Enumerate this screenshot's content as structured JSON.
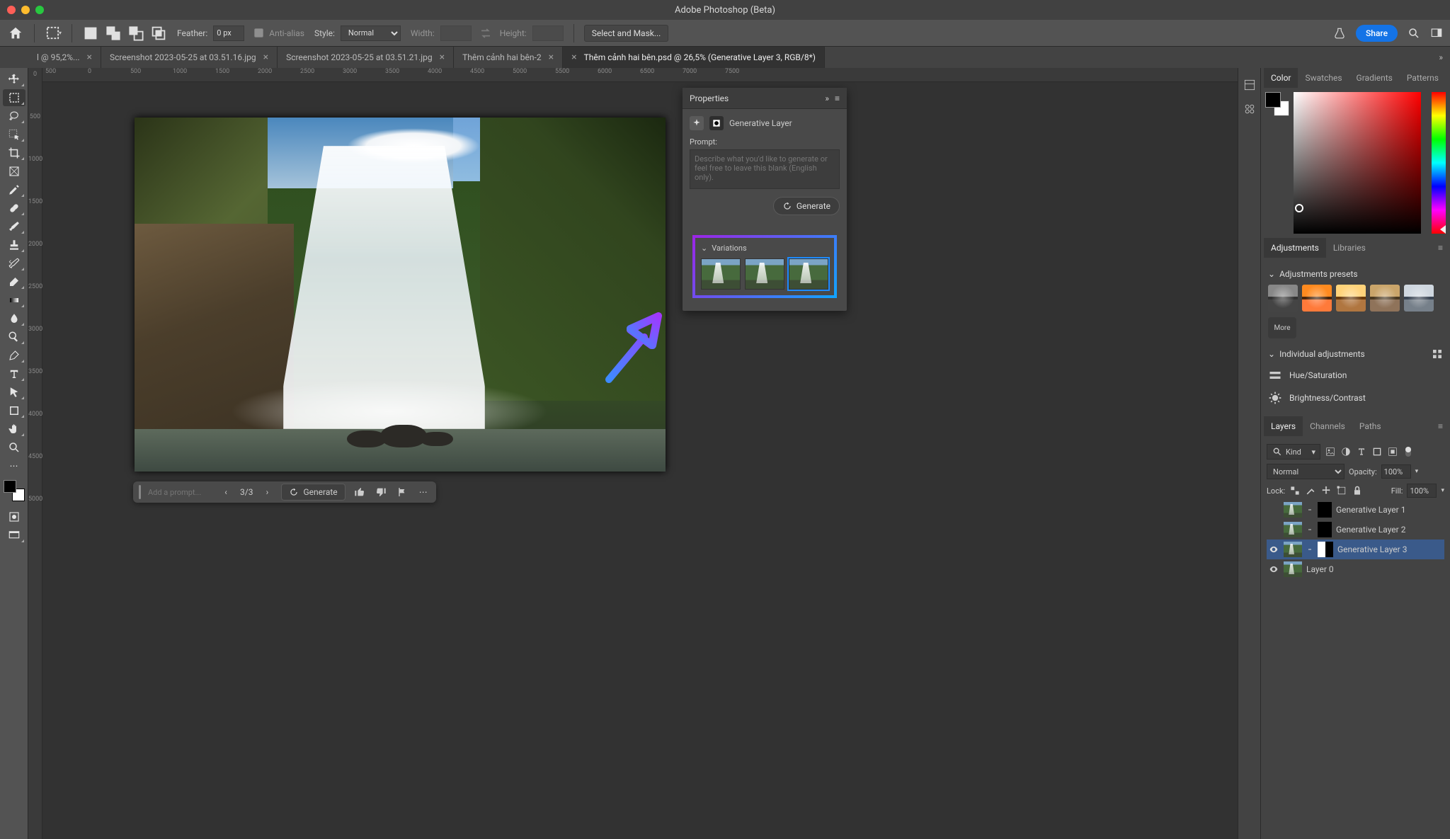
{
  "app": {
    "title": "Adobe Photoshop (Beta)"
  },
  "options": {
    "feather_label": "Feather:",
    "feather_value": "0 px",
    "antialias_label": "Anti-alias",
    "style_label": "Style:",
    "style_value": "Normal",
    "width_label": "Width:",
    "height_label": "Height:",
    "select_mask": "Select and Mask...",
    "share": "Share"
  },
  "tabs": [
    {
      "label": "l @ 95,2%...",
      "active": false
    },
    {
      "label": "Screenshot 2023-05-25 at 03.51.16.jpg",
      "active": false
    },
    {
      "label": "Screenshot 2023-05-25 at 03.51.21.jpg",
      "active": false
    },
    {
      "label": "Thêm cảnh hai bên-2",
      "active": false
    },
    {
      "label": "Thêm cảnh hai bên.psd @ 26,5% (Generative Layer 3, RGB/8*)",
      "active": true
    }
  ],
  "ruler_h": [
    "500",
    "0",
    "500",
    "1000",
    "1500",
    "2000",
    "2500",
    "3000",
    "3500",
    "4000",
    "4500",
    "5000",
    "5500",
    "6000",
    "6500",
    "7000",
    "7500"
  ],
  "ruler_v": [
    "0",
    "500",
    "1000",
    "1500",
    "2000",
    "2500",
    "3000",
    "3500",
    "4000",
    "4500",
    "5000"
  ],
  "promptbar": {
    "placeholder": "Add a prompt...",
    "counter": "3/3",
    "generate": "Generate"
  },
  "properties": {
    "title": "Properties",
    "kind": "Generative Layer",
    "prompt_label": "Prompt:",
    "prompt_placeholder": "Describe what you'd like to generate or feel free to leave this blank (English only).",
    "generate": "Generate",
    "variations_label": "Variations"
  },
  "color_tabs": [
    "Color",
    "Swatches",
    "Gradients",
    "Patterns"
  ],
  "adjustments": {
    "tabs": [
      "Adjustments",
      "Libraries"
    ],
    "presets_label": "Adjustments presets",
    "more": "More",
    "individual_label": "Individual adjustments",
    "items": [
      "Hue/Saturation",
      "Brightness/Contrast"
    ]
  },
  "layers": {
    "tabs": [
      "Layers",
      "Channels",
      "Paths"
    ],
    "filter": "Kind",
    "blend": "Normal",
    "opacity_label": "Opacity:",
    "opacity": "100%",
    "lock_label": "Lock:",
    "fill_label": "Fill:",
    "fill": "100%",
    "items": [
      {
        "name": "Generative Layer 1",
        "visible": false
      },
      {
        "name": "Generative Layer 2",
        "visible": false
      },
      {
        "name": "Generative Layer 3",
        "visible": true,
        "selected": true
      },
      {
        "name": "Layer 0",
        "visible": true,
        "base": true
      }
    ]
  }
}
